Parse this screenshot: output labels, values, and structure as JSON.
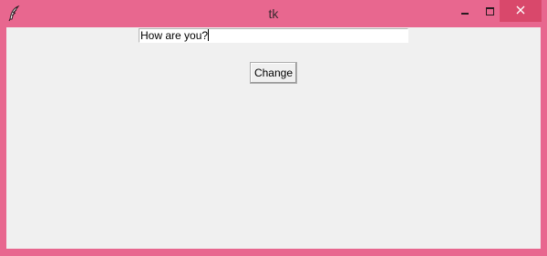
{
  "window": {
    "title": "tk",
    "frame_color": "#e8678f",
    "client_color": "#f0f0f0",
    "icon": "tk-feather-icon",
    "controls": {
      "minimize": "minimize-icon",
      "maximize": "maximize-icon",
      "close": "close-icon",
      "close_color": "#d9486b"
    }
  },
  "entry": {
    "value": "How are you?"
  },
  "button": {
    "label": "Change"
  }
}
